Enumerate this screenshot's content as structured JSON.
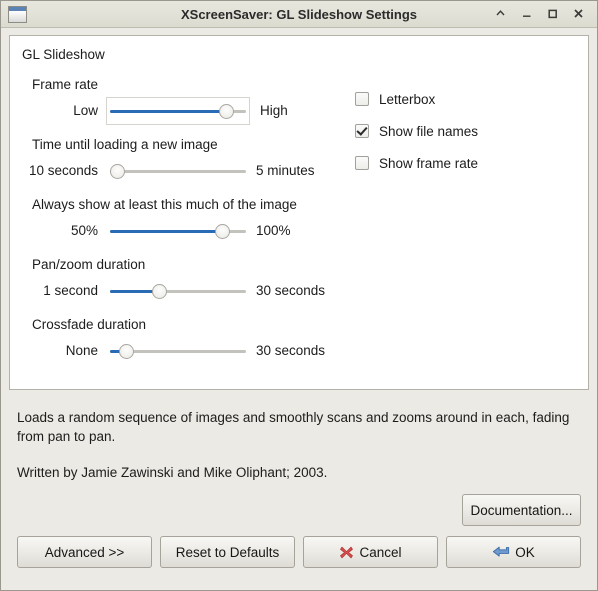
{
  "window": {
    "title": "XScreenSaver: GL Slideshow Settings",
    "icon": "window-icon",
    "controls": [
      {
        "name": "shade-button",
        "glyph": "chevron-up-icon"
      },
      {
        "name": "minimize-button",
        "glyph": "minimize-icon"
      },
      {
        "name": "maximize-button",
        "glyph": "maximize-icon"
      },
      {
        "name": "close-button",
        "glyph": "close-icon"
      }
    ]
  },
  "panel": {
    "title": "GL Slideshow",
    "sliders": [
      {
        "label": "Frame rate",
        "left_label": "Low",
        "right_label": "High",
        "value_pct": 85,
        "focused": true
      },
      {
        "label": "Time until loading a new image",
        "left_label": "10 seconds",
        "right_label": "5 minutes",
        "value_pct": 5,
        "focused": false
      },
      {
        "label": "Always show at least this much of the image",
        "left_label": "50%",
        "right_label": "100%",
        "value_pct": 82,
        "focused": false
      },
      {
        "label": "Pan/zoom duration",
        "left_label": "1 second",
        "right_label": "30 seconds",
        "value_pct": 36,
        "focused": false
      },
      {
        "label": "Crossfade duration",
        "left_label": "None",
        "right_label": "30 seconds",
        "value_pct": 12,
        "focused": false
      }
    ],
    "checkboxes": [
      {
        "label": "Letterbox",
        "checked": false
      },
      {
        "label": "Show file names",
        "checked": true
      },
      {
        "label": "Show frame rate",
        "checked": false
      }
    ]
  },
  "description": {
    "paragraph1": "Loads a random sequence of images and smoothly scans and zooms around in each, fading from pan to pan.",
    "paragraph2": "Written by Jamie Zawinski and Mike Oliphant; 2003."
  },
  "buttons": {
    "documentation": "Documentation...",
    "advanced": "Advanced >>",
    "reset": "Reset to Defaults",
    "cancel": "Cancel",
    "ok": "OK"
  },
  "colors": {
    "accent_blue": "#2a6bb5",
    "window_bg": "#eceae4",
    "panel_bg": "#ffffff",
    "cancel_icon": "#d94b4b",
    "ok_icon": "#4a7fc1"
  }
}
